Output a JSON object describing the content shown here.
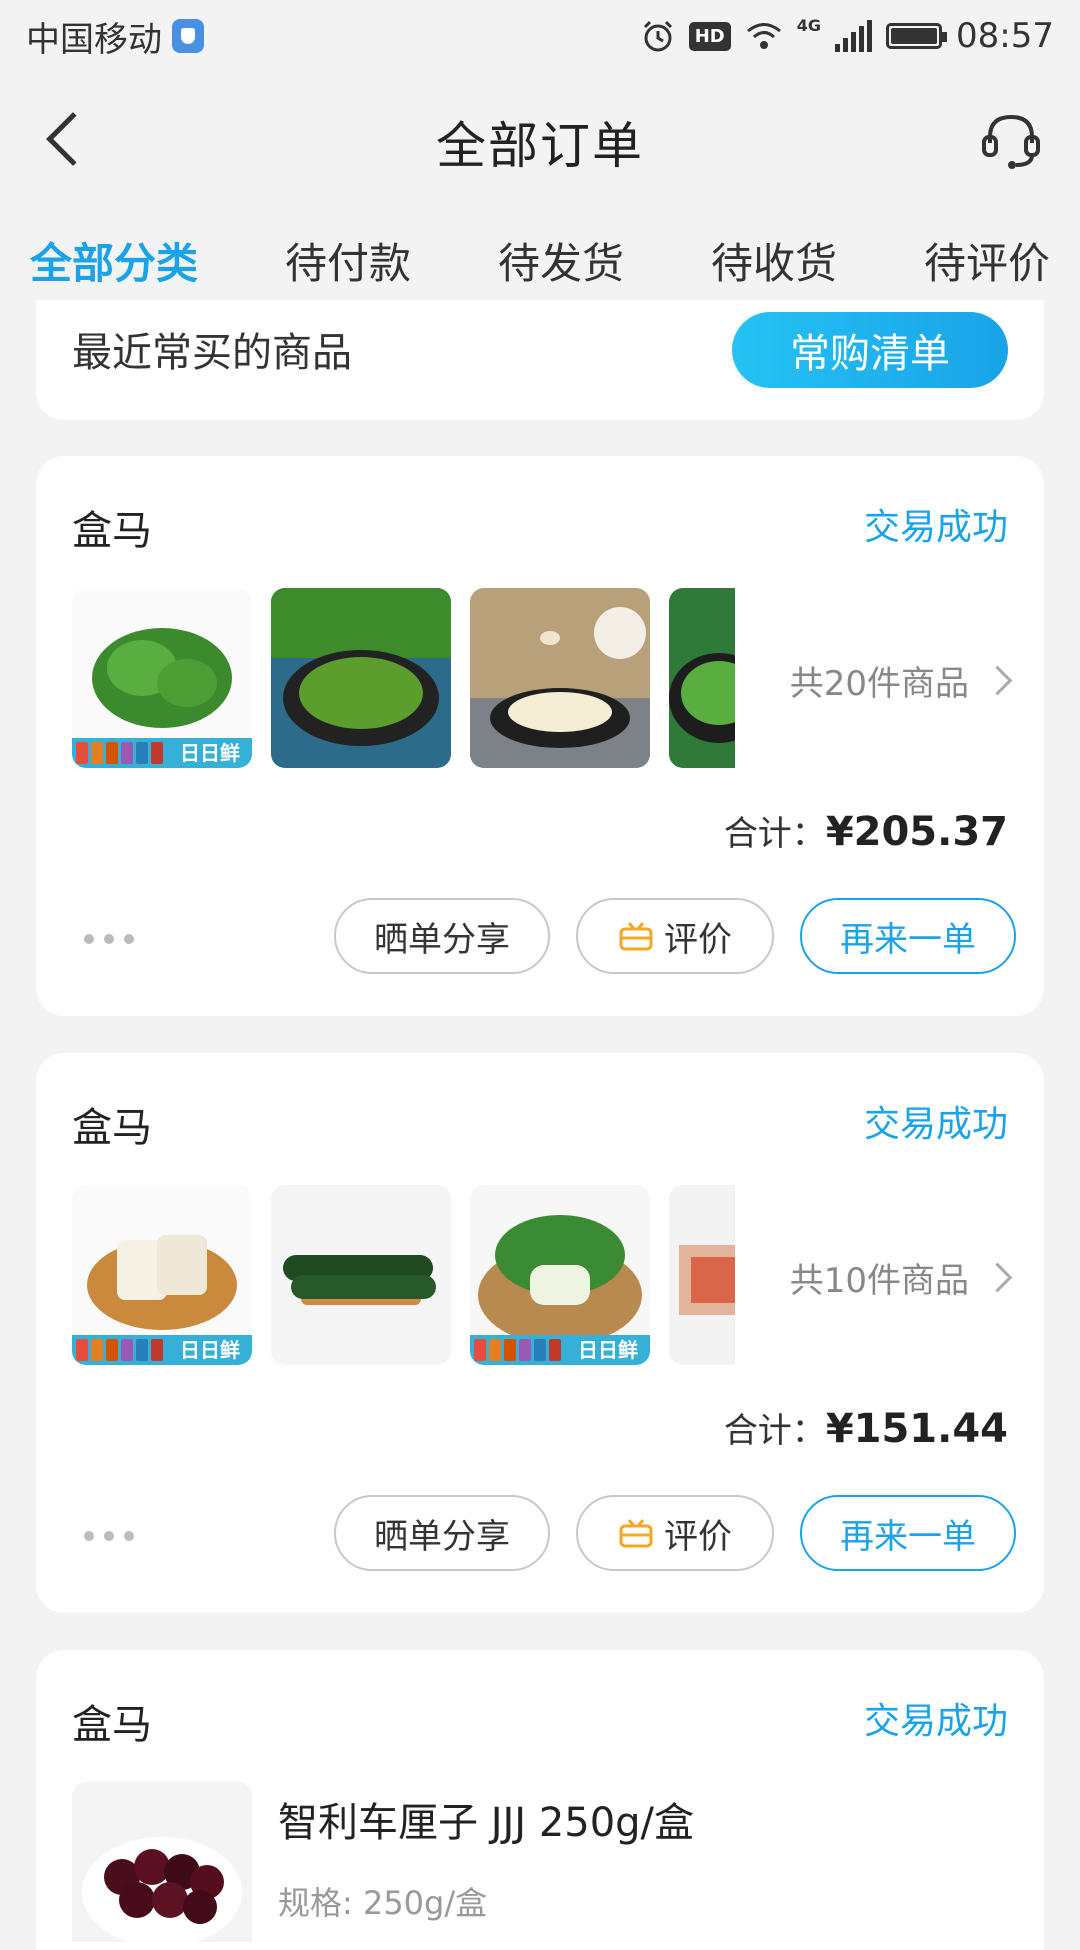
{
  "status_bar": {
    "carrier": "中国移动",
    "network": "4G",
    "time": "08:57"
  },
  "header": {
    "title": "全部订单"
  },
  "tabs": [
    {
      "label": "全部分类",
      "active": true
    },
    {
      "label": "待付款",
      "active": false
    },
    {
      "label": "待发货",
      "active": false
    },
    {
      "label": "待收货",
      "active": false
    },
    {
      "label": "待评价",
      "active": false
    }
  ],
  "recent": {
    "label": "最近常买的商品",
    "button": "常购清单"
  },
  "orders": [
    {
      "store": "盒马",
      "status": "交易成功",
      "count_text": "共20件商品",
      "total_label": "合计：",
      "total_value": "¥205.37",
      "badge_text": "日日鲜",
      "buttons": {
        "share": "晒单分享",
        "review": "评价",
        "again": "再来一单"
      }
    },
    {
      "store": "盒马",
      "status": "交易成功",
      "count_text": "共10件商品",
      "total_label": "合计：",
      "total_value": "¥151.44",
      "badge_text": "日日鲜",
      "buttons": {
        "share": "晒单分享",
        "review": "评价",
        "again": "再来一单"
      }
    },
    {
      "store": "盒马",
      "status": "交易成功",
      "product_name": "智利车厘子 JJJ 250g/盒",
      "product_spec": "规格: 250g/盒"
    }
  ],
  "colors": {
    "accent": "#1aa3e8",
    "background": "#f3f3f3",
    "card": "#ffffff",
    "review_icon": "#f5a623"
  }
}
